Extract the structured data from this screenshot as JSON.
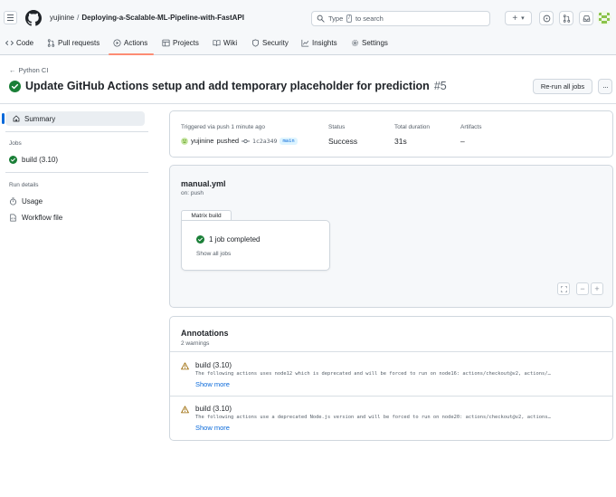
{
  "header": {
    "owner": "yujinine",
    "separator": "/",
    "repo": "Deploying-a-Scalable-ML-Pipeline-with-FastAPI",
    "search_pre": "Type",
    "search_key": "/",
    "search_post": "to search",
    "plus_label": "+",
    "chevron": "▾"
  },
  "repo_nav": {
    "items": [
      {
        "label": "Code",
        "icon": "code-icon"
      },
      {
        "label": "Pull requests",
        "icon": "pull-request-icon"
      },
      {
        "label": "Actions",
        "icon": "play-icon"
      },
      {
        "label": "Projects",
        "icon": "table-icon"
      },
      {
        "label": "Wiki",
        "icon": "book-icon"
      },
      {
        "label": "Security",
        "icon": "shield-icon"
      },
      {
        "label": "Insights",
        "icon": "graph-icon"
      },
      {
        "label": "Settings",
        "icon": "gear-icon"
      }
    ],
    "active_index": 2
  },
  "run": {
    "back_label": "Python CI",
    "title": "Update GitHub Actions setup and add temporary placeholder for prediction",
    "number": "#5",
    "rerun_label": "Re-run all jobs",
    "more_label": "···"
  },
  "sidebar": {
    "summary_label": "Summary",
    "jobs_heading": "Jobs",
    "job_label": "build (3.10)",
    "details_heading": "Run details",
    "usage_label": "Usage",
    "workflow_file_label": "Workflow file"
  },
  "summary": {
    "trigger_label": "Triggered via push 1 minute ago",
    "user": "yujinine",
    "action": "pushed",
    "sha": "1c2a349",
    "branch": "main",
    "status_label": "Status",
    "status_value": "Success",
    "duration_label": "Total duration",
    "duration_value": "31s",
    "artifacts_label": "Artifacts",
    "artifacts_value": "–"
  },
  "workflow": {
    "file": "manual.yml",
    "trigger": "on: push",
    "matrix_label": "Matrix build",
    "jobs_completed": "1 job completed",
    "show_all": "Show all jobs",
    "zoom_minus": "−",
    "zoom_plus": "+"
  },
  "annotations": {
    "title": "Annotations",
    "count": "2 warnings",
    "items": [
      {
        "job": "build (3.10)",
        "message": "The following actions uses node12 which is deprecated and will be forced to run on node16: actions/checkout@v2, actions/…",
        "more": "Show more"
      },
      {
        "job": "build (3.10)",
        "message": "The following actions use a deprecated Node.js version and will be forced to run on node20: actions/checkout@v2, actions…",
        "more": "Show more"
      }
    ]
  },
  "colors": {
    "success": "#1a7f37",
    "warning": "#9a6700",
    "link": "#0969da",
    "accent_underline": "#fd8c73",
    "border": "#d0d7de"
  }
}
